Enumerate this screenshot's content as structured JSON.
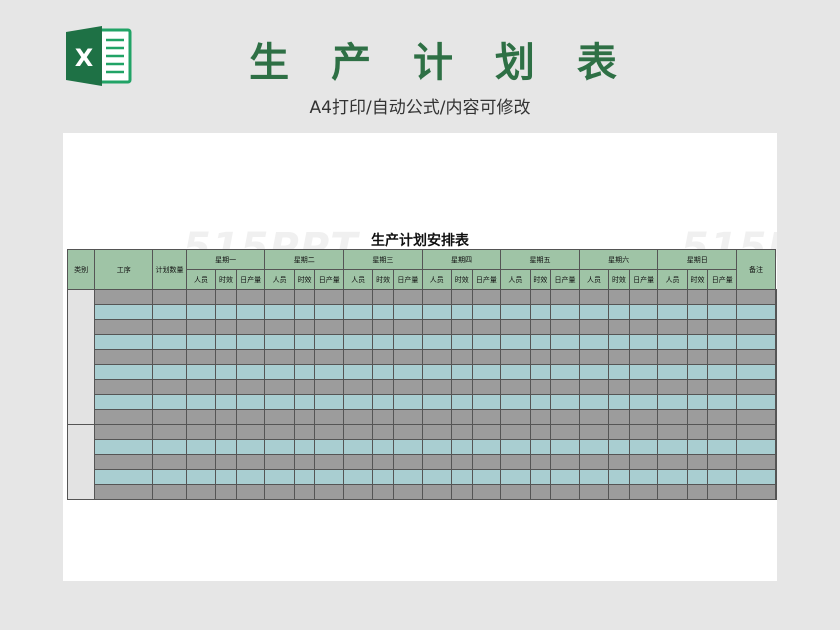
{
  "header": {
    "icon_name": "excel-icon",
    "logo_letter": "X",
    "title": "生 产 计 划 表",
    "subtitle": "A4打印/自动公式/内容可修改"
  },
  "sheet": {
    "watermark": "515PPT",
    "title": "生产计划安排表",
    "columns": {
      "category": "类别",
      "process": "工序",
      "plan_qty": "计划数量",
      "days": [
        "星期一",
        "星期二",
        "星期三",
        "星期四",
        "星期五",
        "星期六",
        "星期日"
      ],
      "sub": [
        "人员",
        "时效",
        "日产量"
      ],
      "notes": "备注"
    },
    "row_pattern": [
      "gray",
      "blue",
      "gray",
      "blue",
      "gray",
      "blue",
      "gray",
      "blue",
      "gray",
      "gray",
      "blue",
      "gray",
      "blue",
      "gray"
    ],
    "category_groups": [
      9,
      5
    ]
  },
  "colors": {
    "brand": "#2e7045",
    "header_fill": "#9fc4a6",
    "row_gray": "#9c9c9c",
    "row_blue": "#a9ced1"
  }
}
